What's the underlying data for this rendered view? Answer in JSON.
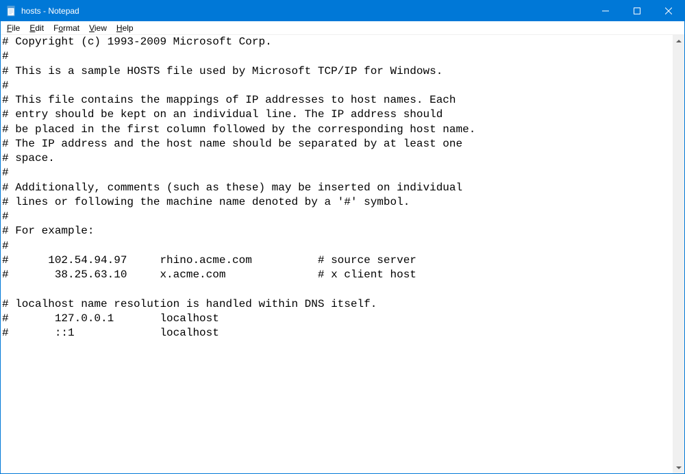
{
  "window": {
    "title": "hosts - Notepad"
  },
  "menus": {
    "file": "File",
    "edit": "Edit",
    "format": "Format",
    "view": "View",
    "help": "Help"
  },
  "document": {
    "content": "# Copyright (c) 1993-2009 Microsoft Corp.\n#\n# This is a sample HOSTS file used by Microsoft TCP/IP for Windows.\n#\n# This file contains the mappings of IP addresses to host names. Each\n# entry should be kept on an individual line. The IP address should\n# be placed in the first column followed by the corresponding host name.\n# The IP address and the host name should be separated by at least one\n# space.\n#\n# Additionally, comments (such as these) may be inserted on individual\n# lines or following the machine name denoted by a '#' symbol.\n#\n# For example:\n#\n#      102.54.94.97     rhino.acme.com          # source server\n#       38.25.63.10     x.acme.com              # x client host\n\n# localhost name resolution is handled within DNS itself.\n#\t127.0.0.1       localhost\n#\t::1             localhost"
  }
}
